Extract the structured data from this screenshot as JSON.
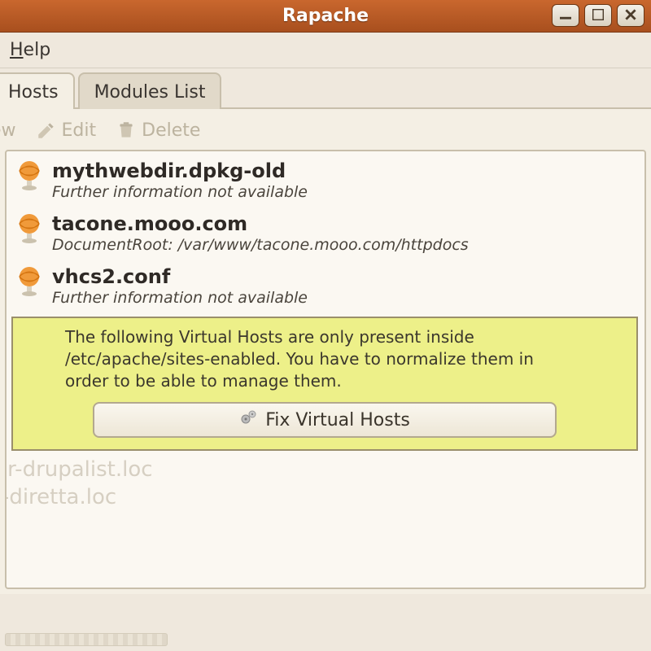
{
  "window": {
    "title": "Rapache"
  },
  "menu": {
    "help": "Help"
  },
  "tabs": {
    "hosts": "Hosts",
    "modules": "Modules List"
  },
  "toolbar": {
    "new": "ew",
    "edit": "Edit",
    "delete": "Delete"
  },
  "vhosts": [
    {
      "name": "mythwebdir.dpkg-old",
      "detail": "Further information not available"
    },
    {
      "name": "tacone.mooo.com",
      "detail": "DocumentRoot: /var/www/tacone.mooo.com/httpdocs"
    },
    {
      "name": "vhcs2.conf",
      "detail": "Further information not available"
    }
  ],
  "warning": {
    "text": "The following  Virtual Hosts are only present inside /etc/apache/sites-enabled. You have to normalize them in order to be able to manage them.",
    "button": "Fix Virtual Hosts"
  },
  "disabled_items": [
    "air-drupalist.loc",
    "a-diretta.loc"
  ]
}
